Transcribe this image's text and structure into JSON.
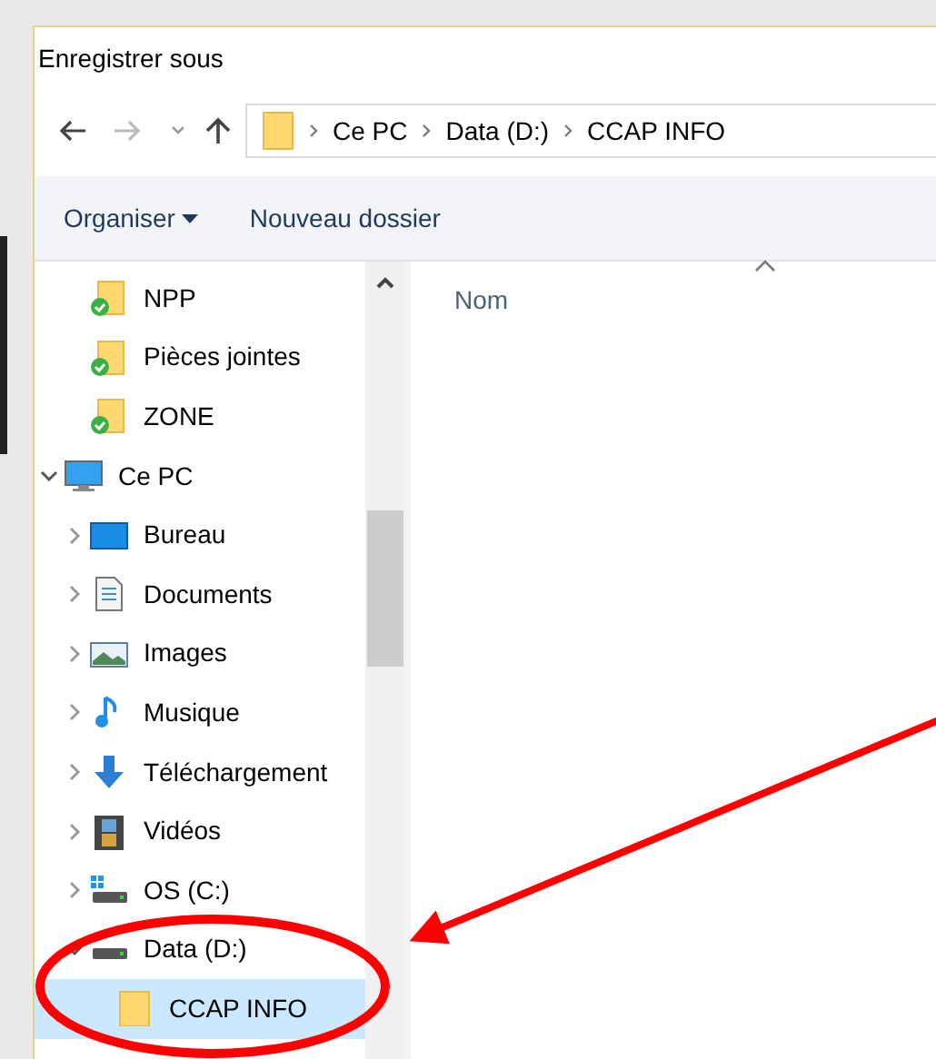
{
  "window": {
    "title": "Enregistrer sous"
  },
  "address_bar": {
    "crumbs": [
      "Ce PC",
      "Data (D:)",
      "CCAP INFO"
    ]
  },
  "toolbar": {
    "organize": "Organiser",
    "new_folder": "Nouveau dossier"
  },
  "nav_pane": {
    "items": [
      {
        "label": "NPP",
        "kind": "synced-folder",
        "selected": false
      },
      {
        "label": "Pièces jointes",
        "kind": "synced-folder",
        "selected": false
      },
      {
        "label": "ZONE",
        "kind": "synced-folder",
        "selected": false
      },
      {
        "label": "Ce PC",
        "kind": "pc",
        "expanded": true,
        "selected": false,
        "children": [
          {
            "label": "Bureau",
            "kind": "desktop",
            "expanded": false,
            "selected": false
          },
          {
            "label": "Documents",
            "kind": "documents",
            "expanded": false,
            "selected": false
          },
          {
            "label": "Images",
            "kind": "images",
            "expanded": false,
            "selected": false
          },
          {
            "label": "Musique",
            "kind": "music",
            "expanded": false,
            "selected": false
          },
          {
            "label": "Téléchargement",
            "kind": "downloads",
            "expanded": false,
            "selected": false
          },
          {
            "label": "Vidéos",
            "kind": "videos",
            "expanded": false,
            "selected": false
          },
          {
            "label": "OS (C:)",
            "kind": "os-drive",
            "expanded": false,
            "selected": false
          },
          {
            "label": "Data (D:)",
            "kind": "drive",
            "expanded": true,
            "selected": false,
            "children": [
              {
                "label": "CCAP INFO",
                "kind": "folder",
                "selected": true
              }
            ]
          }
        ]
      }
    ]
  },
  "file_list": {
    "columns": [
      "Nom"
    ]
  }
}
